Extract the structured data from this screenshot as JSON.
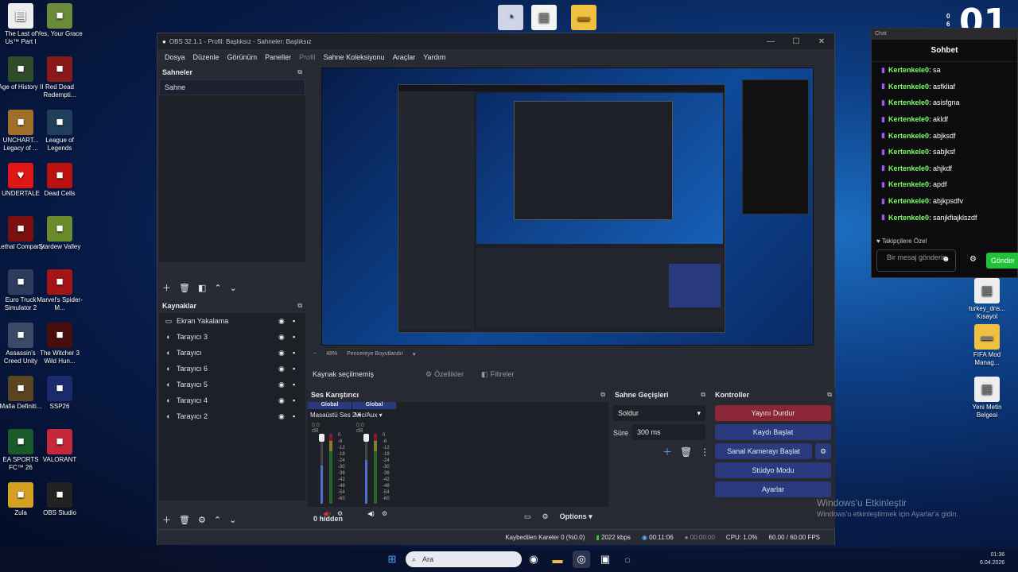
{
  "desktop_icons_left": [
    {
      "label": "The Last of Us™ Part I",
      "icon": "document-icon",
      "color": "#eeeeee"
    },
    {
      "label": "Yes, Your Grace",
      "icon": "game-icon",
      "color": "#6b8a3a"
    },
    {
      "label": "Age of History II",
      "icon": "game-icon",
      "color": "#2f4d2b"
    },
    {
      "label": "Red Dead Redempti...",
      "icon": "game-icon",
      "color": "#8a1a1a"
    },
    {
      "label": "UNCHART... Legacy of ...",
      "icon": "game-icon",
      "color": "#a0702a"
    },
    {
      "label": "League of Legends",
      "icon": "game-icon",
      "color": "#1f3f5a"
    },
    {
      "label": "UNDERTALE",
      "icon": "heart-icon",
      "color": "#e01616"
    },
    {
      "label": "Dead Cells",
      "icon": "game-icon",
      "color": "#b11"
    },
    {
      "label": "Lethal Company",
      "icon": "game-icon",
      "color": "#7a1010"
    },
    {
      "label": "Stardew Valley",
      "icon": "game-icon",
      "color": "#6a8c2a"
    },
    {
      "label": "Euro Truck Simulator 2",
      "icon": "game-icon",
      "color": "#2b3c5c"
    },
    {
      "label": "Marvel's Spider-M...",
      "icon": "game-icon",
      "color": "#a51515"
    },
    {
      "label": "Assassin's Creed Unity",
      "icon": "game-icon",
      "color": "#3a4a66"
    },
    {
      "label": "The Witcher 3 Wild Hun...",
      "icon": "game-icon",
      "color": "#4a0d0d"
    },
    {
      "label": "Mafia Definiti...",
      "icon": "game-icon",
      "color": "#5a4520"
    },
    {
      "label": "SSP26",
      "icon": "game-icon",
      "color": "#1a2a6a"
    },
    {
      "label": "EA SPORTS FC™ 26",
      "icon": "game-icon",
      "color": "#1a5a2a"
    },
    {
      "label": "VALORANT",
      "icon": "game-icon",
      "color": "#c4283a"
    },
    {
      "label": "Zula",
      "icon": "game-icon",
      "color": "#d4a020"
    },
    {
      "label": "OBS Studio",
      "icon": "obs-icon",
      "color": "#222222"
    }
  ],
  "desktop_icons_right": [
    {
      "label": "turkey_dns... Kısayol",
      "icon": "shortcut-icon"
    },
    {
      "label": "FIFA Mod Manag...",
      "icon": "folder-icon"
    },
    {
      "label": "Yeni Metin Belgesi",
      "icon": "document-icon"
    }
  ],
  "clock_big": {
    "digits": "01",
    "side_top": "0",
    "side_bottom": "6"
  },
  "obs": {
    "title": "OBS 32.1.1 - Profil: Başlıksız - Sahneler: Başlıksız",
    "menu": [
      "Dosya",
      "Düzenle",
      "Görünüm",
      "Paneller",
      "Profil",
      "Sahne Koleksiyonu",
      "Araçlar",
      "Yardım"
    ],
    "scenes_title": "Sahneler",
    "scenes": [
      "Sahne"
    ],
    "sources_title": "Kaynaklar",
    "sources": [
      {
        "name": "Ekran Yakalama",
        "icon": "monitor-icon"
      },
      {
        "name": "Tarayıcı 3",
        "icon": "globe-icon"
      },
      {
        "name": "Tarayıcı",
        "icon": "globe-icon"
      },
      {
        "name": "Tarayıcı 6",
        "icon": "globe-icon"
      },
      {
        "name": "Tarayıcı 5",
        "icon": "globe-icon"
      },
      {
        "name": "Tarayıcı 4",
        "icon": "globe-icon"
      },
      {
        "name": "Tarayıcı 2",
        "icon": "globe-icon"
      }
    ],
    "zoom": "48%",
    "zoom_mode": "Pencereye Boyutlandır",
    "no_source": "Kaynak seçilmemiş",
    "properties": "Özellikler",
    "filters": "Filtreler",
    "mixer_title": "Ses Karıştırıcı",
    "mixer": [
      {
        "scope": "Global",
        "name": "Masaüstü Ses 2",
        "db": "0.0 dB",
        "level": 0.55
      },
      {
        "scope": "Global",
        "name": "Mic/Aux",
        "db": "0.0 dB",
        "level": 0.62
      }
    ],
    "scale": [
      "0",
      "-6",
      "-12",
      "-18",
      "-24",
      "-30",
      "-36",
      "-42",
      "-48",
      "-54",
      "-60"
    ],
    "hidden": "0 hidden",
    "options": "Options",
    "transitions_title": "Sahne Geçişleri",
    "transition": "Soldur",
    "duration_label": "Süre",
    "duration": "300 ms",
    "controls_title": "Kontroller",
    "controls": [
      "Yayını Durdur",
      "Kaydı Başlat",
      "Sanal Kamerayı Başlat",
      "Stüdyo Modu",
      "Ayarlar"
    ],
    "status": {
      "dropped": "Kaybedilen Kareler 0 (%0.0)",
      "bitrate": "2022 kbps",
      "stream_time": "00:11:06",
      "rec_time": "00:00:00",
      "cpu": "CPU: 1.0%",
      "fps": "60.00 / 60.00 FPS"
    }
  },
  "chat": {
    "header": "Chat",
    "title": "Sohbet",
    "messages": [
      {
        "user": "Kertenkele0:",
        "text": "sa"
      },
      {
        "user": "Kertenkele0:",
        "text": "asfkliaf"
      },
      {
        "user": "Kertenkele0:",
        "text": "asisfgna"
      },
      {
        "user": "Kertenkele0:",
        "text": "akldf"
      },
      {
        "user": "Kertenkele0:",
        "text": "abjksdf"
      },
      {
        "user": "Kertenkele0:",
        "text": "sabjksf"
      },
      {
        "user": "Kertenkele0:",
        "text": "ahjkdf"
      },
      {
        "user": "Kertenkele0:",
        "text": "apdf"
      },
      {
        "user": "Kertenkele0:",
        "text": "abjkpsdfv"
      },
      {
        "user": "Kertenkele0:",
        "text": "sanjkfiajklszdf"
      }
    ],
    "followers": "Takipçilere Özel",
    "placeholder": "Bir mesaj gönderin",
    "send": "Gönder"
  },
  "watermark": {
    "title": "Windows'u Etkinleştir",
    "sub": "Windows'u etkinleştirmek için Ayarlar'a gidin."
  },
  "taskbar": {
    "search": "Ara",
    "time": "01:36",
    "date": "6.04.2026"
  }
}
